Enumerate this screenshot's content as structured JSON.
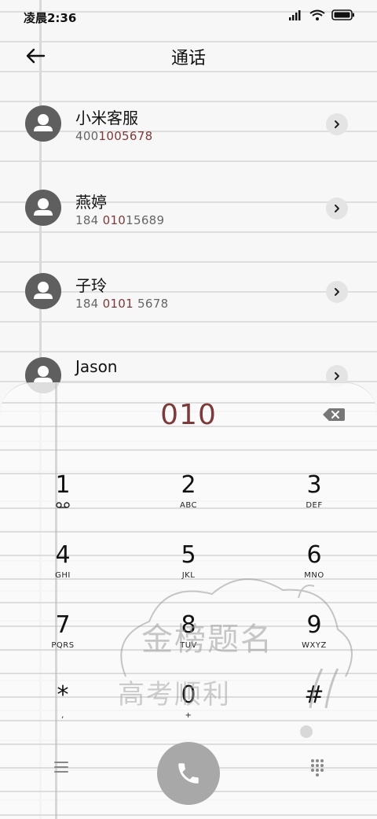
{
  "status_bar": {
    "time": "凌晨2:36",
    "icons": [
      "signal-icon",
      "wifi-icon",
      "battery-icon"
    ]
  },
  "header": {
    "title": "通话",
    "back_icon": "back-arrow-icon"
  },
  "contacts": [
    {
      "name": "小米客服",
      "number_pre": "400",
      "number_hl": "1005678",
      "number_post": "",
      "number_full": "4001005678"
    },
    {
      "name": "燕婷",
      "number_pre": "184 ",
      "number_hl": "010",
      "number_post": "15689"
    },
    {
      "name": "子玲",
      "number_pre": "184 ",
      "number_hl": "0101",
      "number_post": " 5678"
    },
    {
      "name": "Jason",
      "number_pre": "",
      "number_hl": "",
      "number_post": ""
    }
  ],
  "dialer": {
    "input": "010",
    "keys": [
      {
        "digit": "1",
        "letters": ""
      },
      {
        "digit": "2",
        "letters": "ABC"
      },
      {
        "digit": "3",
        "letters": "DEF"
      },
      {
        "digit": "4",
        "letters": "GHI"
      },
      {
        "digit": "5",
        "letters": "JKL"
      },
      {
        "digit": "6",
        "letters": "MNO"
      },
      {
        "digit": "7",
        "letters": "PQRS"
      },
      {
        "digit": "8",
        "letters": "TUV"
      },
      {
        "digit": "9",
        "letters": "WXYZ"
      },
      {
        "digit": "*",
        "letters": ","
      },
      {
        "digit": "0",
        "letters": "+"
      },
      {
        "digit": "#",
        "letters": ""
      }
    ]
  },
  "watermark": {
    "line1": "金榜题名",
    "line2": "高考顺利"
  },
  "colors": {
    "highlight": "#7c3a3a",
    "avatar": "#5f5f5f",
    "call_button": "#a8a8a8"
  }
}
